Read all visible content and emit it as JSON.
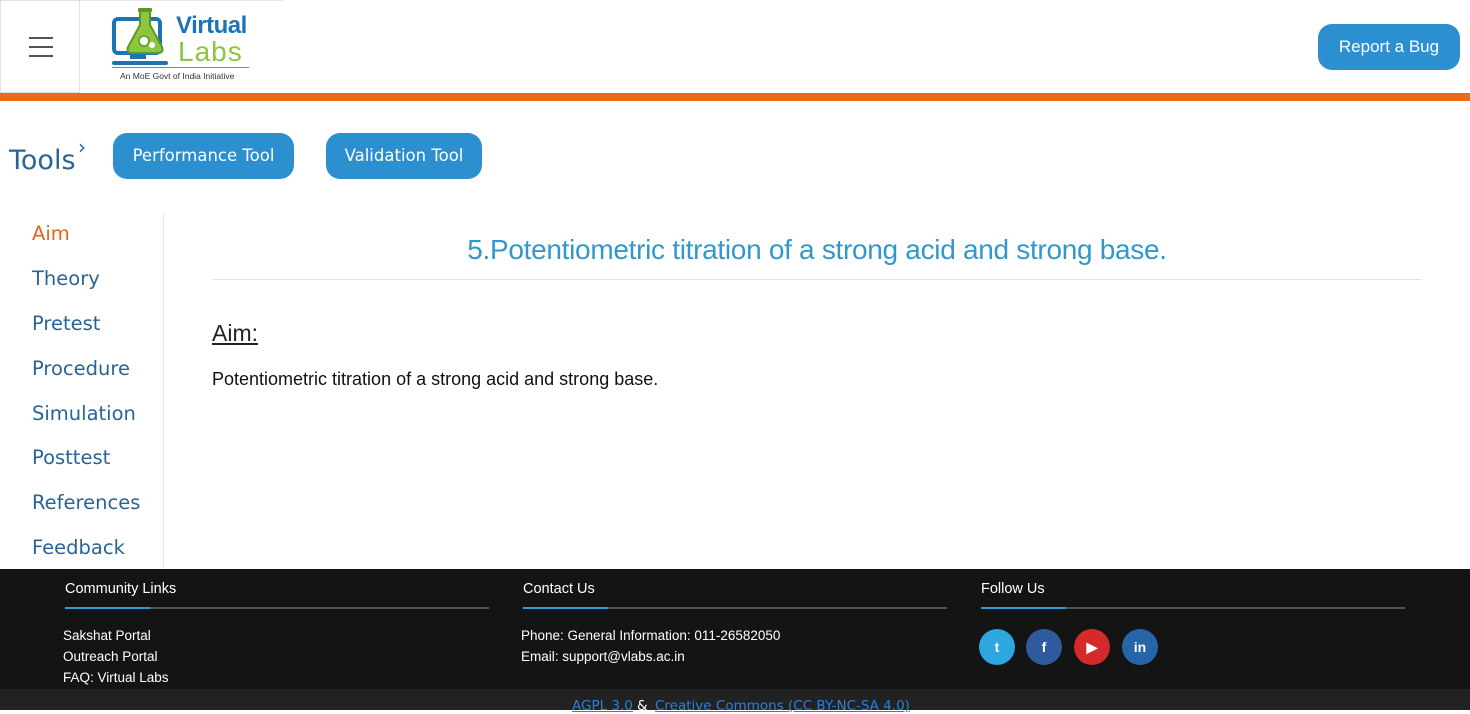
{
  "header": {
    "menu_icon": "hamburger-menu-icon",
    "logo": {
      "word1": "Virtual",
      "word2": "Labs",
      "tagline": "An MoE Govt of India Initiative"
    },
    "report_bug_label": "Report a Bug",
    "colors": {
      "accent_bar": "#ec6a17",
      "button": "#2b8fd0"
    }
  },
  "tools": {
    "label": "Tools",
    "chevron_icon": "chevron-right-icon",
    "buttons": [
      "Performance Tool",
      "Validation Tool"
    ]
  },
  "sidebar": {
    "items": [
      {
        "label": "Aim",
        "active": true
      },
      {
        "label": "Theory",
        "active": false
      },
      {
        "label": "Pretest",
        "active": false
      },
      {
        "label": "Procedure",
        "active": false
      },
      {
        "label": "Simulation",
        "active": false
      },
      {
        "label": "Posttest",
        "active": false
      },
      {
        "label": "References",
        "active": false
      },
      {
        "label": "Feedback",
        "active": false
      }
    ]
  },
  "main": {
    "title": "5.Potentiometric titration of a strong acid and strong base.",
    "section_heading": "Aim:",
    "section_text": "Potentiometric titration of a strong acid and strong base."
  },
  "footer": {
    "community": {
      "title": "Community Links",
      "links": [
        "Sakshat Portal",
        "Outreach Portal",
        "FAQ: Virtual Labs"
      ]
    },
    "contact": {
      "title": "Contact Us",
      "phone": "Phone: General Information: 011-26582050",
      "email": "Email: support@vlabs.ac.in"
    },
    "follow": {
      "title": "Follow Us",
      "icons": [
        "twitter-icon",
        "facebook-icon",
        "youtube-icon",
        "linkedin-icon"
      ]
    },
    "license": {
      "link1": "AGPL 3.0",
      "separator": "&",
      "link2": "Creative Commons (CC BY-NC-SA 4.0)"
    }
  }
}
